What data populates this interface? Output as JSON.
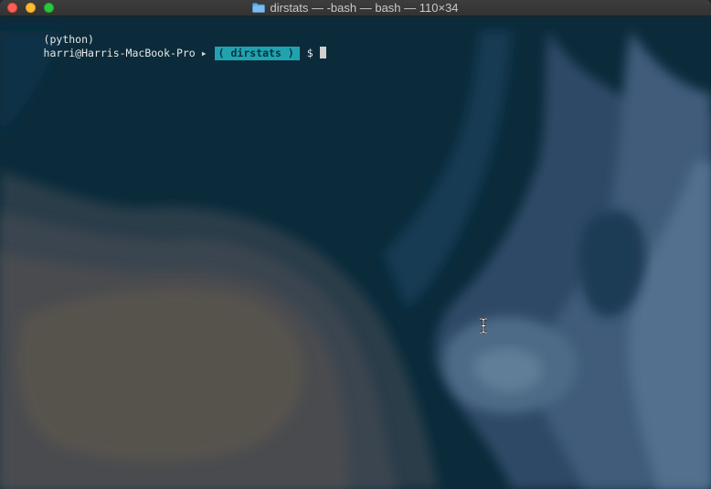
{
  "window": {
    "title": "dirstats — -bash — bash — 110×34",
    "folder_icon": "folder-icon"
  },
  "terminal": {
    "prompt": {
      "env": "(python)",
      "user_host": "harri@Harris-MacBook-Pro",
      "separator": "▸",
      "directory": "( dirstats )",
      "symbol": "$"
    },
    "cursor_icon": "block-cursor",
    "mouse_pointer": "ibeam-cursor-icon"
  },
  "colors": {
    "titlebar": "#383838",
    "close": "#fe5f57",
    "minimize": "#febc2e",
    "maximize": "#28c840",
    "directory_badge": "#20a3b0",
    "background_dark": "#0e2a3b"
  }
}
